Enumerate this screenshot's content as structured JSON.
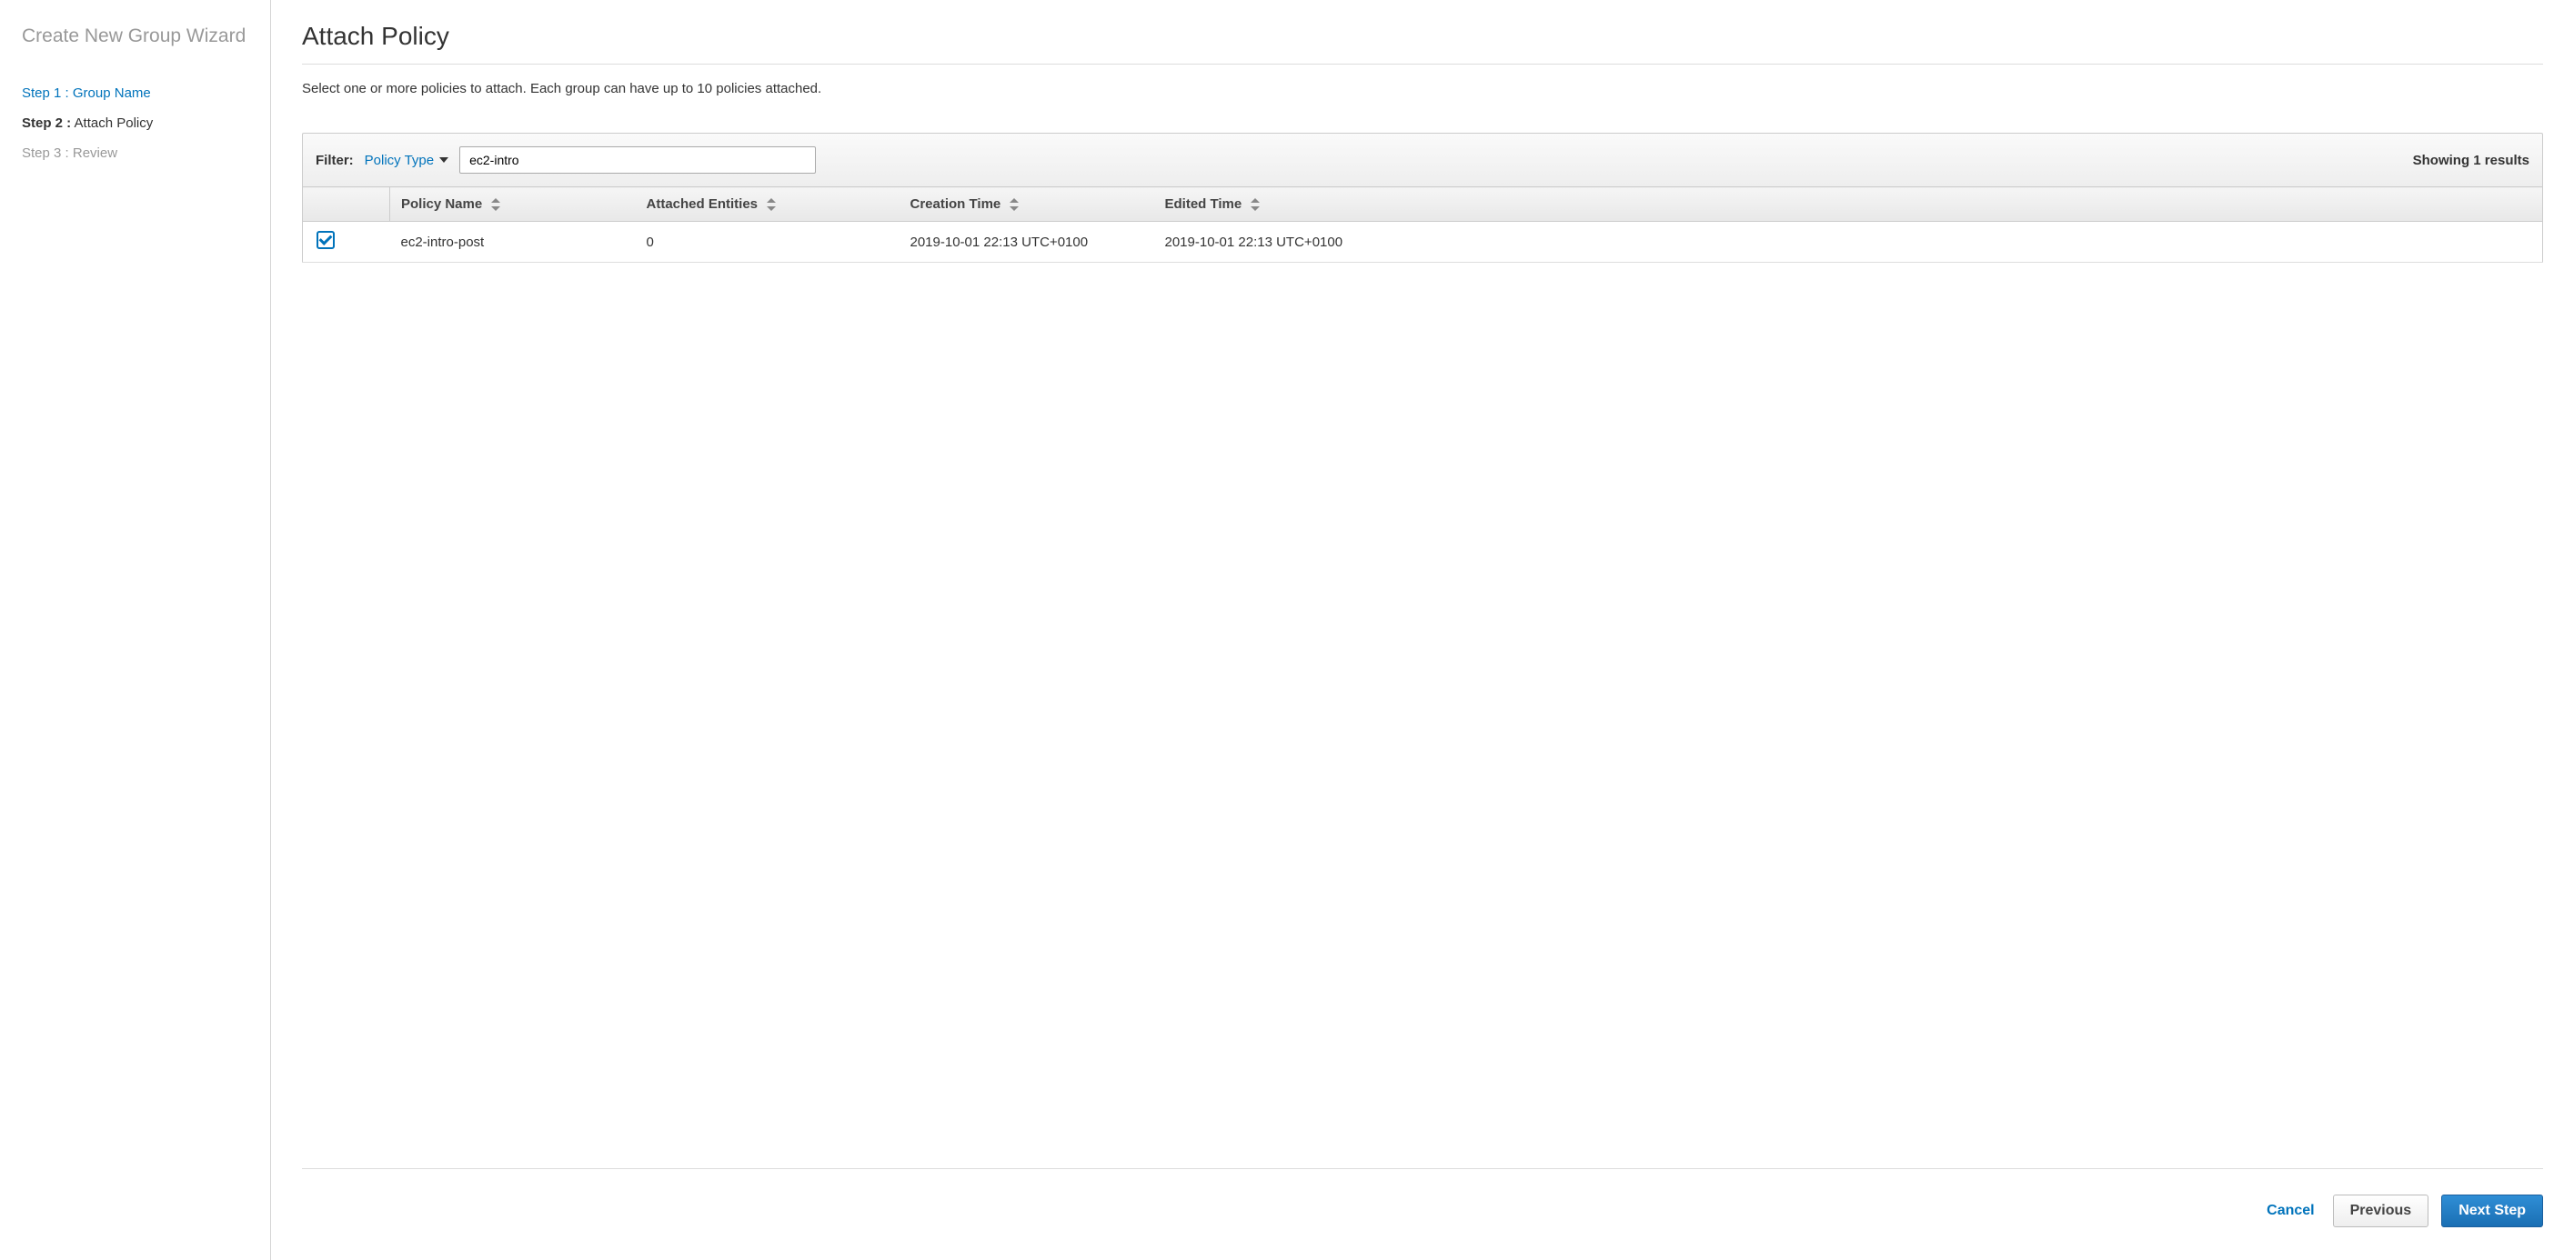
{
  "sidebar": {
    "title": "Create New Group Wizard",
    "steps": [
      {
        "prefix": "Step 1 :",
        "label": "Group Name",
        "state": "link"
      },
      {
        "prefix": "Step 2 :",
        "label": "Attach Policy",
        "state": "active"
      },
      {
        "prefix": "Step 3 :",
        "label": "Review",
        "state": "disabled"
      }
    ]
  },
  "main": {
    "title": "Attach Policy",
    "description": "Select one or more policies to attach. Each group can have up to 10 policies attached.",
    "filter": {
      "label": "Filter:",
      "type_label": "Policy Type",
      "search_value": "ec2-intro",
      "results_text": "Showing 1 results"
    },
    "table": {
      "headers": {
        "policy_name": "Policy Name",
        "attached_entities": "Attached Entities",
        "creation_time": "Creation Time",
        "edited_time": "Edited Time"
      },
      "rows": [
        {
          "checked": true,
          "policy_name": "ec2-intro-post",
          "attached_entities": "0",
          "creation_time": "2019-10-01 22:13 UTC+0100",
          "edited_time": "2019-10-01 22:13 UTC+0100"
        }
      ]
    }
  },
  "footer": {
    "cancel": "Cancel",
    "previous": "Previous",
    "next": "Next Step"
  }
}
